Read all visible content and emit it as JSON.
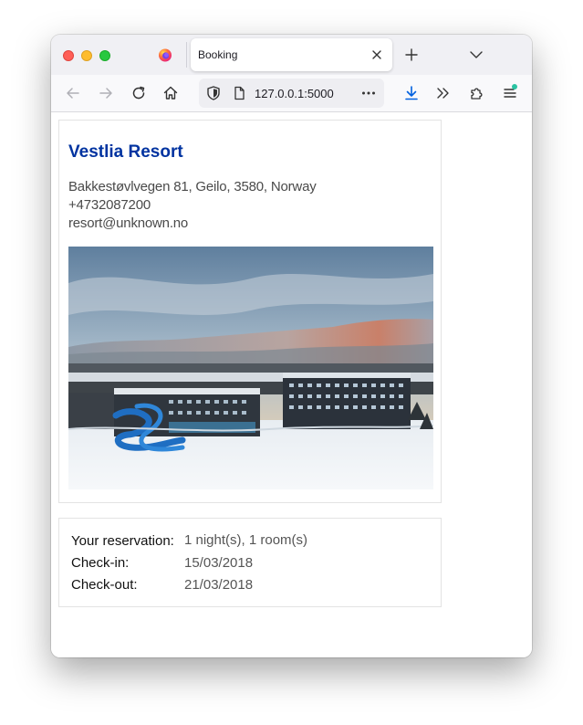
{
  "browser": {
    "tab_title": "Booking",
    "url": "127.0.0.1:5000",
    "icons": {
      "back": "arrow-left-icon",
      "forward": "arrow-right-icon",
      "reload": "reload-icon",
      "home": "home-icon",
      "tracking": "shield-icon",
      "page_info": "page-icon",
      "more": "more-dots-icon",
      "downloads": "download-icon",
      "overflow": "chevron-double-right-icon",
      "extensions": "puzzle-icon",
      "menu": "hamburger-menu-icon"
    }
  },
  "hotel": {
    "name": "Vestlia Resort",
    "address": "Bakkestøvlvegen 81, Geilo, 3580, Norway",
    "phone": "+4732087200",
    "email": "resort@unknown.no",
    "photo_alt": "Vestlia Resort"
  },
  "reservation": {
    "summary_label": "Your reservation:",
    "summary_value": "1 night(s), 1 room(s)",
    "checkin_label": "Check-in:",
    "checkin_value": "15/03/2018",
    "checkout_label": "Check-out:",
    "checkout_value": "21/03/2018"
  },
  "colors": {
    "hotel_name": "#0033a0",
    "download_accent": "#0060df",
    "notification_dot": "#2ac3a2"
  }
}
